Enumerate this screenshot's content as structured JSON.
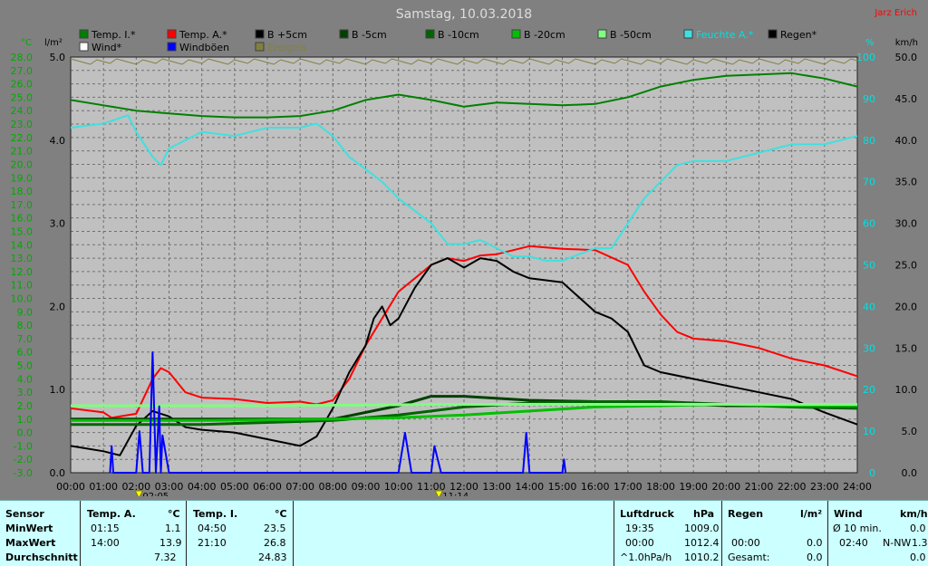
{
  "chart_data": {
    "type": "line",
    "title": "Samstag, 10.03.2018",
    "author": "Jarz Erich",
    "x_hours": [
      "00:00",
      "01:00",
      "02:00",
      "03:00",
      "04:00",
      "05:00",
      "06:00",
      "07:00",
      "08:00",
      "09:00",
      "10:00",
      "11:00",
      "12:00",
      "13:00",
      "14:00",
      "15:00",
      "16:00",
      "17:00",
      "18:00",
      "19:00",
      "20:00",
      "21:00",
      "22:00",
      "23:00",
      "24:00"
    ],
    "axes": {
      "temp_unit": "°C",
      "temp_range": [
        -3.0,
        28.0
      ],
      "temp_ticks": [
        "28.0",
        "27.0",
        "26.0",
        "25.0",
        "24.0",
        "23.0",
        "22.0",
        "21.0",
        "20.0",
        "19.0",
        "18.0",
        "17.0",
        "16.0",
        "15.0",
        "14.0",
        "13.0",
        "12.0",
        "11.0",
        "10.0",
        "9.0",
        "8.0",
        "7.0",
        "6.0",
        "5.0",
        "4.0",
        "3.0",
        "2.0",
        "1.0",
        "0.0",
        "-1.0",
        "-2.0",
        "-3.0"
      ],
      "rain_unit": "l/m²",
      "rain_range": [
        0.0,
        5.0
      ],
      "rain_ticks": [
        "5.0",
        "4.0",
        "3.0",
        "2.0",
        "1.0",
        "0.0"
      ],
      "humidity_unit": "%",
      "humidity_range": [
        0,
        100
      ],
      "humidity_ticks": [
        "100",
        "90",
        "80",
        "70",
        "60",
        "50",
        "40",
        "30",
        "20",
        "10",
        "0"
      ],
      "wind_unit": "km/h",
      "wind_range": [
        0.0,
        50.0
      ],
      "wind_ticks": [
        "50.0",
        "45.0",
        "40.0",
        "35.0",
        "30.0",
        "25.0",
        "20.0",
        "15.0",
        "10.0",
        "5.0",
        "0.0"
      ]
    },
    "legend": [
      {
        "name": "Temp. I.*",
        "color": "#008000"
      },
      {
        "name": "Temp. A.*",
        "color": "#ff0000"
      },
      {
        "name": "B +5cm",
        "color": "#000000"
      },
      {
        "name": "B -5cm",
        "color": "#004000"
      },
      {
        "name": "B -10cm",
        "color": "#006400"
      },
      {
        "name": "B -20cm",
        "color": "#00c000"
      },
      {
        "name": "B -50cm",
        "color": "#80ff80"
      },
      {
        "name": "Feuchte A.*",
        "color": "#40e0e0"
      },
      {
        "name": "Regen*",
        "color": "#000000"
      },
      {
        "name": "Wind*",
        "color": "#ffffff"
      },
      {
        "name": "Windböen",
        "color": "#0000ff"
      },
      {
        "name": "Ereignis",
        "color": "#808040"
      }
    ],
    "series": [
      {
        "name": "Temp. I.*",
        "axis": "temp",
        "color": "#008000",
        "x": [
          0,
          1,
          2,
          3,
          4,
          5,
          6,
          7,
          8,
          9,
          10,
          11,
          12,
          13,
          14,
          15,
          16,
          17,
          18,
          19,
          20,
          21,
          22,
          23,
          24
        ],
        "values": [
          24.8,
          24.4,
          24.0,
          23.8,
          23.6,
          23.5,
          23.5,
          23.6,
          24.0,
          24.8,
          25.2,
          24.8,
          24.3,
          24.6,
          24.5,
          24.4,
          24.5,
          25.0,
          25.8,
          26.3,
          26.6,
          26.7,
          26.8,
          26.4,
          25.8
        ]
      },
      {
        "name": "Temp. A.*",
        "axis": "temp",
        "color": "#ff0000",
        "x": [
          0,
          1,
          1.25,
          2,
          2.5,
          2.75,
          3,
          3.5,
          4,
          5,
          6,
          7,
          7.5,
          8,
          8.5,
          9,
          9.5,
          10,
          10.5,
          11,
          11.5,
          12,
          12.5,
          13,
          14,
          15,
          16,
          17,
          17.5,
          18,
          18.5,
          19,
          20,
          21,
          22,
          23,
          24
        ],
        "values": [
          1.8,
          1.5,
          1.1,
          1.4,
          4.0,
          4.8,
          4.5,
          3.0,
          2.6,
          2.5,
          2.2,
          2.3,
          2.1,
          2.4,
          4.0,
          6.5,
          8.5,
          10.5,
          11.5,
          12.5,
          13.0,
          12.8,
          13.2,
          13.3,
          13.9,
          13.7,
          13.6,
          12.5,
          10.5,
          8.8,
          7.5,
          7.0,
          6.8,
          6.3,
          5.5,
          5.0,
          4.2
        ]
      },
      {
        "name": "B +5cm",
        "axis": "temp",
        "color": "#000000",
        "x": [
          0,
          1,
          1.5,
          2,
          2.5,
          3,
          3.5,
          4,
          5,
          6,
          7,
          7.5,
          8,
          8.5,
          9,
          9.25,
          9.5,
          9.75,
          10,
          10.5,
          11,
          11.5,
          12,
          12.5,
          13,
          13.5,
          14,
          15,
          16,
          16.5,
          17,
          17.5,
          18,
          19,
          20,
          21,
          22,
          23,
          24
        ],
        "values": [
          -1.0,
          -1.4,
          -1.7,
          0.5,
          1.6,
          1.2,
          0.4,
          0.2,
          0.0,
          -0.5,
          -1.0,
          -0.3,
          1.8,
          4.5,
          6.5,
          8.5,
          9.4,
          8.0,
          8.5,
          10.8,
          12.5,
          13.0,
          12.3,
          13.0,
          12.8,
          12.0,
          11.5,
          11.2,
          9.0,
          8.5,
          7.5,
          5.0,
          4.5,
          4.0,
          3.5,
          3.0,
          2.5,
          1.5,
          0.6
        ]
      },
      {
        "name": "B -5cm",
        "axis": "temp",
        "color": "#004000",
        "x": [
          0,
          4,
          8,
          10,
          11,
          12,
          14,
          16,
          18,
          20,
          22,
          24
        ],
        "values": [
          1.0,
          1.0,
          1.0,
          2.0,
          2.7,
          2.7,
          2.4,
          2.3,
          2.2,
          2.0,
          2.0,
          1.9
        ]
      },
      {
        "name": "B -10cm",
        "axis": "temp",
        "color": "#006400",
        "x": [
          0,
          4,
          8,
          10,
          11,
          12,
          14,
          16,
          18,
          20,
          22,
          24
        ],
        "values": [
          0.6,
          0.6,
          0.9,
          1.3,
          1.6,
          1.9,
          2.2,
          2.3,
          2.3,
          2.1,
          1.9,
          1.8
        ]
      },
      {
        "name": "B -20cm",
        "axis": "temp",
        "color": "#00c000",
        "x": [
          0,
          4,
          8,
          10,
          12,
          14,
          16,
          18,
          20,
          22,
          24
        ],
        "values": [
          0.9,
          0.9,
          1.0,
          1.1,
          1.3,
          1.6,
          1.9,
          2.0,
          2.1,
          2.0,
          2.0
        ]
      },
      {
        "name": "B -50cm",
        "axis": "temp",
        "color": "#80ff80",
        "x": [
          0,
          6,
          12,
          18,
          24
        ],
        "values": [
          2.0,
          2.0,
          2.1,
          2.1,
          2.1
        ]
      },
      {
        "name": "Feuchte A.*",
        "axis": "humidity",
        "color": "#40e0e0",
        "x": [
          0,
          1,
          1.75,
          2,
          2.5,
          2.75,
          3,
          3.5,
          4,
          5,
          6,
          7,
          7.5,
          8,
          8.5,
          9,
          9.5,
          10,
          10.5,
          11,
          11.5,
          12,
          12.5,
          13,
          13.5,
          14,
          14.5,
          15,
          16,
          16.5,
          17,
          17.5,
          18,
          18.5,
          19,
          20,
          21,
          22,
          23,
          24
        ],
        "values": [
          83,
          84,
          86,
          82,
          76,
          74,
          78,
          80,
          82,
          81,
          83,
          83,
          84,
          81,
          76,
          73,
          70,
          66,
          63,
          60,
          55,
          55,
          56,
          54,
          52,
          52,
          51,
          51,
          54,
          54,
          60,
          66,
          70,
          74,
          75,
          75,
          77,
          79,
          79,
          81
        ]
      },
      {
        "name": "Windböen",
        "axis": "wind",
        "color": "#0000ff",
        "x": [
          1.2,
          1.25,
          1.3,
          2.0,
          2.1,
          2.2,
          2.4,
          2.5,
          2.6,
          2.7,
          2.75,
          2.8,
          3.0,
          10.0,
          10.2,
          10.4,
          11.0,
          11.1,
          11.3,
          13.8,
          13.9,
          14.0,
          15.0,
          15.05,
          15.1
        ],
        "values": [
          0,
          3.2,
          0,
          0,
          5.0,
          0,
          0,
          14.5,
          0,
          8.0,
          0,
          4.5,
          0,
          0,
          4.8,
          0,
          0,
          3.2,
          0,
          0,
          4.8,
          0,
          0,
          1.6,
          0
        ]
      }
    ],
    "event_markers": [
      "02:05",
      "11:14"
    ],
    "grid": true
  },
  "header": {
    "left_unit_temp": "°C",
    "left_unit_rain": "l/m²",
    "right_unit_humidity": "%",
    "right_unit_wind": "km/h"
  },
  "stats": {
    "row_labels": [
      "Sensor",
      "MinWert",
      "MaxWert",
      "Durchschnitt"
    ],
    "temp_a": {
      "header": "Temp. A.",
      "unit": "°C",
      "min_time": "01:15",
      "min": "1.1",
      "max_time": "14:00",
      "max": "13.9",
      "avg": "7.32"
    },
    "temp_i": {
      "header": "Temp. I.",
      "unit": "°C",
      "min_time": "04:50",
      "min": "23.5",
      "max_time": "21:10",
      "max": "26.8",
      "avg": "24.83"
    },
    "pressure": {
      "header": "Luftdruck",
      "unit": "hPa",
      "min_time": "19:35",
      "min": "1009.0",
      "max_time": "00:00",
      "max": "1012.4",
      "avg_label": "^1.0hPa/h",
      "avg": "1010.2"
    },
    "rain": {
      "header": "Regen",
      "unit": "l/m²",
      "max_time": "00:00",
      "max": "0.0",
      "total_label": "Gesamt:",
      "total": "0.0"
    },
    "wind": {
      "header": "Wind",
      "unit": "km/h",
      "avg_label": "Ø 10 min.",
      "avg": "0.0",
      "max_time": "02:40",
      "max_dir": "N-NW",
      "max": "1.3",
      "total": "0.0"
    }
  }
}
